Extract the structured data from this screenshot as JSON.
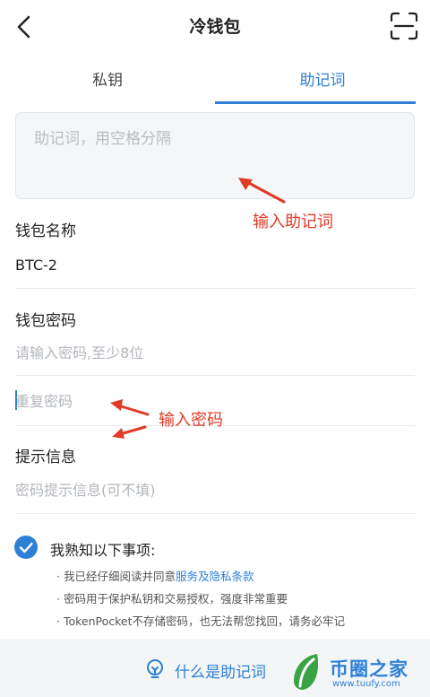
{
  "header": {
    "title": "冷钱包",
    "back_icon": "chevron-left-icon",
    "scan_icon": "scan-icon"
  },
  "tabs": [
    {
      "label": "私钥",
      "active": false
    },
    {
      "label": "助记词",
      "active": true
    }
  ],
  "mnemonic": {
    "placeholder": "助记词，用空格分隔",
    "value": ""
  },
  "annotations": {
    "mnemonic_hint": "输入助记词",
    "password_hint": "输入密码"
  },
  "wallet_name": {
    "label": "钱包名称",
    "value": "BTC-2"
  },
  "wallet_password": {
    "label": "钱包密码",
    "placeholder": "请输入密码,至少8位",
    "repeat_placeholder": "重复密码"
  },
  "hint_info": {
    "label": "提示信息",
    "placeholder": "密码提示信息(可不填)"
  },
  "notice": {
    "checked": true,
    "title": "我熟知以下事项:",
    "item1_prefix": "· 我已经仔细阅读并同意",
    "item1_link": "服务及隐私条款",
    "item2": "· 密码用于保护私钥和交易授权，强度非常重要",
    "item3": "· TokenPocket不存储密码，也无法帮您找回，请务必牢记"
  },
  "footer": {
    "help_icon": "bulb-icon",
    "help_text": "什么是助记词"
  },
  "watermark": {
    "name": "币圈之家",
    "url": "www.tuufy.com"
  },
  "colors": {
    "accent": "#2d80d6",
    "annotation": "#e03a26"
  }
}
